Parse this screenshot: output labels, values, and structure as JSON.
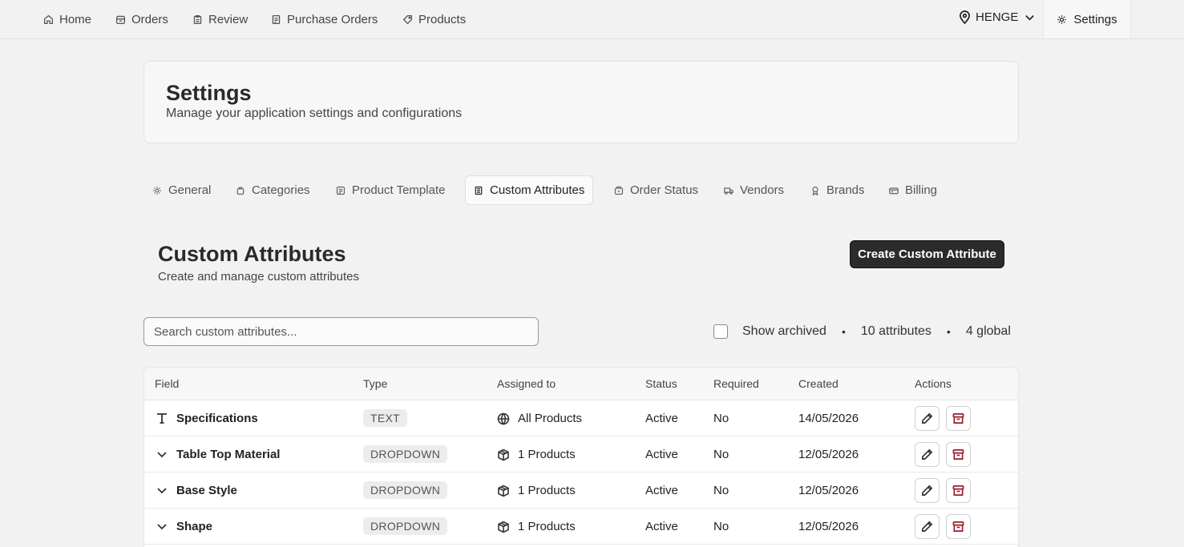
{
  "nav": {
    "items": [
      {
        "label": "Home",
        "icon": "home-icon"
      },
      {
        "label": "Orders",
        "icon": "orders-icon"
      },
      {
        "label": "Review",
        "icon": "clipboard-icon"
      },
      {
        "label": "Purchase Orders",
        "icon": "purchase-orders-icon"
      },
      {
        "label": "Products",
        "icon": "tag-icon"
      }
    ],
    "location": "HENGE",
    "settings_label": "Settings"
  },
  "header": {
    "title": "Settings",
    "subtitle": "Manage your application settings and configurations"
  },
  "tabs": [
    {
      "label": "General",
      "icon": "gear-icon"
    },
    {
      "label": "Categories",
      "icon": "categories-icon"
    },
    {
      "label": "Product Template",
      "icon": "template-icon"
    },
    {
      "label": "Custom Attributes",
      "icon": "attributes-icon"
    },
    {
      "label": "Order Status",
      "icon": "order-status-icon"
    },
    {
      "label": "Vendors",
      "icon": "truck-icon"
    },
    {
      "label": "Brands",
      "icon": "brand-icon"
    },
    {
      "label": "Billing",
      "icon": "billing-icon"
    }
  ],
  "active_tab": "Custom Attributes",
  "section": {
    "title": "Custom Attributes",
    "subtitle": "Create and manage custom attributes",
    "create_label": "Create Custom Attribute"
  },
  "search": {
    "placeholder": "Search custom attributes...",
    "value": ""
  },
  "meta": {
    "show_archived": "Show archived",
    "show_archived_checked": false,
    "count": "10 attributes",
    "global": "4 global",
    "separator": "•"
  },
  "table": {
    "headers": {
      "field": "Field",
      "type": "Type",
      "assigned": "Assigned to",
      "status": "Status",
      "required": "Required",
      "created": "Created",
      "actions": "Actions"
    },
    "rows": [
      {
        "name": "Specifications",
        "icon": "text-icon",
        "type": "TEXT",
        "assigned": "All Products",
        "assigned_icon": "globe-icon",
        "status": "Active",
        "required": "No",
        "created": "14/05/2026"
      },
      {
        "name": "Table Top Material",
        "icon": "chevron-down-icon",
        "type": "DROPDOWN",
        "assigned": "1 Products",
        "assigned_icon": "box-icon",
        "status": "Active",
        "required": "No",
        "created": "12/05/2026"
      },
      {
        "name": "Base Style",
        "icon": "chevron-down-icon",
        "type": "DROPDOWN",
        "assigned": "1 Products",
        "assigned_icon": "box-icon",
        "status": "Active",
        "required": "No",
        "created": "12/05/2026"
      },
      {
        "name": "Shape",
        "icon": "chevron-down-icon",
        "type": "DROPDOWN",
        "assigned": "1 Products",
        "assigned_icon": "box-icon",
        "status": "Active",
        "required": "No",
        "created": "12/05/2026"
      }
    ]
  },
  "colors": {
    "primary_button": "#2b2b2b",
    "archive_icon": "#9b1c2c",
    "background": "#f2f2f2"
  }
}
